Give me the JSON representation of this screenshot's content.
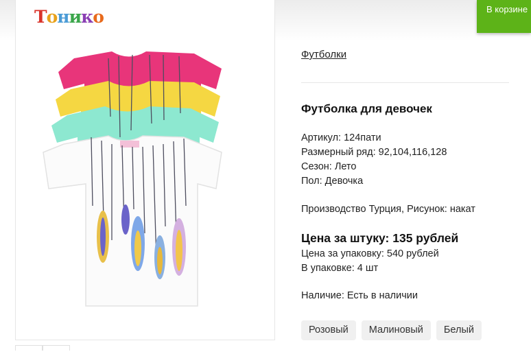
{
  "brand": {
    "logo_text": "Тоникo"
  },
  "cart": {
    "label": "В корзине"
  },
  "product": {
    "breadcrumb": "Футболки",
    "title": "Футболка для девочек",
    "properties": [
      "Артикул: 124пати",
      "Размерный ряд: 92,104,116,128",
      "Сезон: Лето",
      "Пол: Девочка"
    ],
    "production": "Производство Турция, Рисунок: накат",
    "price_unit": "Цена за штуку: 135 рублей",
    "price_pack": "Цена за упаковку: 540 рублей",
    "pack_count": "В упаковке: 4 шт",
    "availability": "Наличие: Есть в наличии",
    "colors": [
      "Розовый",
      "Малиновый",
      "Белый"
    ],
    "tshirt_colors": [
      "#e8357a",
      "#f5d742",
      "#8de8d0",
      "#ffffff"
    ]
  },
  "logo_letter_colors": [
    "#d9342b",
    "#e8a21c",
    "#4a9bd6",
    "#3aa64a",
    "#8a3fb3",
    "#e86a1c"
  ]
}
